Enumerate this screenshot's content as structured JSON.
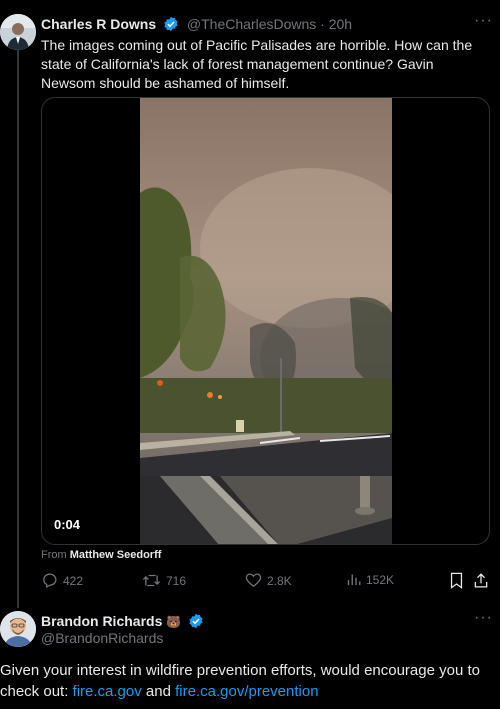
{
  "tweet1": {
    "name": "Charles R Downs",
    "handle_time": "@TheCharlesDowns · 20h",
    "text": "The images coming out of  Pacific Palisades are horrible. How can the state of California's lack of forest management continue? Gavin Newsom should be ashamed of himself.",
    "video_time": "0:04",
    "from_prefix": "From",
    "from_name": "Matthew Seedorff",
    "actions": {
      "replies": "422",
      "retweets": "716",
      "likes": "2.8K",
      "views": "152K"
    }
  },
  "tweet2": {
    "name": "Brandon Richards",
    "emoji": "🐻",
    "handle": "@BrandonRichards",
    "text_before": "Given your interest in wildfire prevention efforts, would encourage you to check out: ",
    "link1": "fire.ca.gov",
    "text_mid": " and ",
    "link2": "fire.ca.gov/prevention"
  },
  "icons": {
    "more": "more-icon",
    "verified": "verified-badge-icon",
    "reply": "reply-icon",
    "retweet": "retweet-icon",
    "like": "heart-icon",
    "views": "views-icon",
    "bookmark": "bookmark-icon",
    "share": "share-icon"
  },
  "colors": {
    "background": "#000000",
    "text": "#e7e9ea",
    "muted": "#71767b",
    "accent": "#1d9bf0"
  }
}
